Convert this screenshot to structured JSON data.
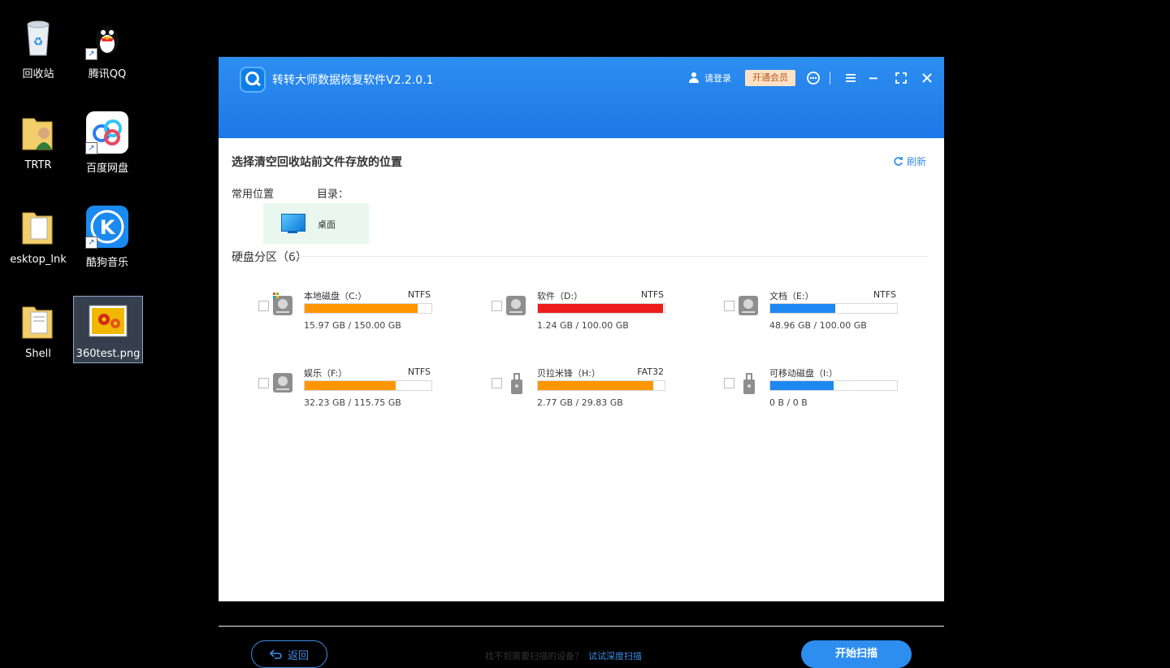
{
  "desktop": {
    "icons": [
      {
        "label": "回收站"
      },
      {
        "label": "腾讯QQ"
      },
      {
        "label": "TRTR"
      },
      {
        "label": "百度网盘"
      },
      {
        "label": "esktop_lnk"
      },
      {
        "label": "酷狗音乐"
      },
      {
        "label": "Shell"
      },
      {
        "label": "360test.png"
      }
    ]
  },
  "window": {
    "title": "转转大师数据恢复软件V2.2.0.1",
    "login_label": "请登录",
    "vip_label": "开通会员",
    "controls": [
      "support-icon",
      "menu-icon",
      "minimize-icon",
      "maximize-icon",
      "close-icon"
    ]
  },
  "main": {
    "section_title": "选择清空回收站前文件存放的位置",
    "refresh_label": "刷新",
    "common_location_label": "常用位置",
    "directory_label": "目录：",
    "desktop_tile_label": "桌面",
    "partition_label": "硬盘分区（6）",
    "drives": [
      {
        "name": "本地磁盘（C:）",
        "fs": "NTFS",
        "size": "15.97 GB / 150.00 GB",
        "fill_pct": 89,
        "color": "#ff9600",
        "icon": "hdd-system-icon"
      },
      {
        "name": "软件（D:）",
        "fs": "NTFS",
        "size": "1.24 GB / 100.00 GB",
        "fill_pct": 99,
        "color": "#ee1c1c",
        "icon": "hdd-icon"
      },
      {
        "name": "文档（E:）",
        "fs": "NTFS",
        "size": "48.96 GB / 100.00 GB",
        "fill_pct": 51,
        "color": "#1e88f0",
        "icon": "hdd-icon"
      },
      {
        "name": "娱乐（F:）",
        "fs": "NTFS",
        "size": "32.23 GB / 115.75 GB",
        "fill_pct": 72,
        "color": "#ff9600",
        "icon": "hdd-icon"
      },
      {
        "name": "贝拉米锋（H:）",
        "fs": "FAT32",
        "size": "2.77 GB / 29.83 GB",
        "fill_pct": 91,
        "color": "#ff9600",
        "icon": "usb-drive-icon"
      },
      {
        "name": "可移动磁盘（I:）",
        "fs": "",
        "size": "0 B / 0 B",
        "fill_pct": 50,
        "color": "#1e88f0",
        "icon": "usb-drive-icon"
      }
    ]
  },
  "footer": {
    "back_label": "返回",
    "hint_text": "找不到需要扫描的设备？",
    "hint_link": "试试深度扫描",
    "start_label": "开始扫描"
  }
}
